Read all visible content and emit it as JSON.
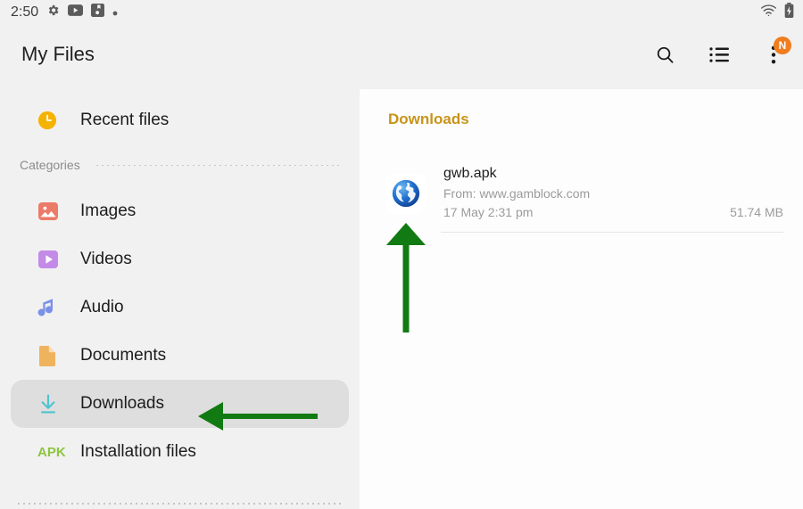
{
  "status_bar": {
    "clock": "2:50",
    "left_icons": [
      "gear-icon",
      "youtube-icon",
      "app-save-icon",
      "dot-icon"
    ],
    "right_icons": [
      "wifi-icon",
      "battery-charging-icon"
    ]
  },
  "header": {
    "title": "My Files",
    "actions": [
      {
        "name": "search-icon",
        "label": "Search"
      },
      {
        "name": "list-view-icon",
        "label": "View as"
      },
      {
        "name": "more-options-icon",
        "label": "More options",
        "badge": "N",
        "badge_color": "#f07d1e"
      }
    ]
  },
  "sidebar": {
    "recent": {
      "label": "Recent files",
      "icon": "clock-icon",
      "color": "#f5b301"
    },
    "categories_label": "Categories",
    "items": [
      {
        "label": "Images",
        "icon": "image-icon",
        "color": "#ec7a68"
      },
      {
        "label": "Videos",
        "icon": "video-play-icon",
        "color": "#c38ae8"
      },
      {
        "label": "Audio",
        "icon": "music-note-icon",
        "color": "#7b91e8"
      },
      {
        "label": "Documents",
        "icon": "document-icon",
        "color": "#f0b35d"
      },
      {
        "label": "Downloads",
        "icon": "download-icon",
        "color": "#4ec3cf",
        "selected": true
      },
      {
        "label": "Installation files",
        "icon": "apk-icon",
        "color": "#8cc63f",
        "icon_text": "APK"
      }
    ]
  },
  "content": {
    "heading": "Downloads",
    "heading_color": "#c8941a",
    "files": [
      {
        "name": "gwb.apk",
        "source": "From: www.gamblock.com",
        "date": "17 May 2:31 pm",
        "size": "51.74 MB",
        "icon": "globe-icon"
      }
    ]
  },
  "annotations": {
    "color": "#127a12",
    "arrows": [
      {
        "name": "up-arrow-annotation",
        "direction": "up",
        "points_to": "file-globe-icon"
      },
      {
        "name": "left-arrow-annotation",
        "direction": "left",
        "points_to": "sidebar-item-downloads"
      }
    ]
  }
}
